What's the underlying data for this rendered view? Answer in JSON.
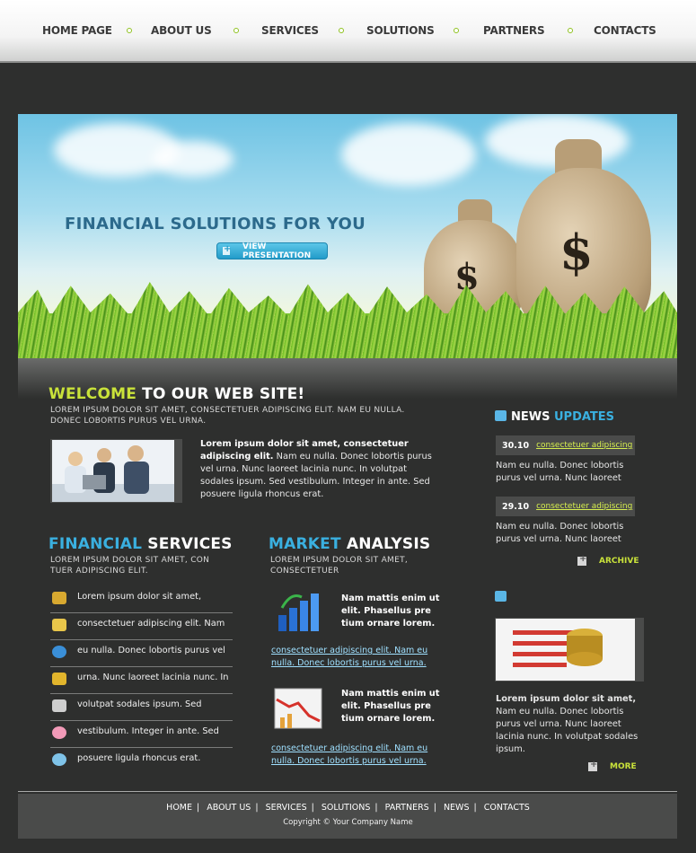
{
  "nav": {
    "items": [
      "HOME PAGE",
      "ABOUT US",
      "SERVICES",
      "SOLUTIONS",
      "PARTNERS",
      "CONTACTS"
    ]
  },
  "hero": {
    "title": "FINANCIAL SOLUTIONS FOR YOU",
    "button_label": "VIEW PRESENTATION"
  },
  "welcome": {
    "title_highlight": "WELCOME",
    "title_rest": " TO OUR WEB SITE!",
    "subtitle": "LOREM IPSUM DOLOR SIT AMET, CONSECTETUER ADIPISCING ELIT. NAM EU NULLA. DONEC LOBORTIS PURUS VEL URNA.",
    "lead_bold": "Lorem ipsum dolor sit amet, consectetuer adipiscing elit.",
    "lead_text": " Nam eu nulla. Donec lobortis purus vel urna. Nunc laoreet lacinia nunc. In volutpat sodales ipsum. Sed vestibulum. Integer in ante. Sed posuere ligula rhoncus erat."
  },
  "services": {
    "title_highlight": "FINANCIAL",
    "title_rest": " SERVICES",
    "subtitle": "LOREM IPSUM DOLOR SIT AMET, CON TUER ADIPISCING ELIT.",
    "items": [
      {
        "text": "Lorem ipsum dolor sit amet,",
        "icon": "chart-icon",
        "color": "#d8a930"
      },
      {
        "text": "consectetuer adipiscing elit. Nam",
        "icon": "cash-icon",
        "color": "#e8c64a"
      },
      {
        "text": "eu nulla. Donec lobortis purus vel",
        "icon": "euro-icon",
        "color": "#3a8fd8"
      },
      {
        "text": "urna. Nunc laoreet lacinia nunc. In",
        "icon": "coins-icon",
        "color": "#e2b52c"
      },
      {
        "text": "volutpat sodales ipsum. Sed",
        "icon": "calculator-icon",
        "color": "#cfcfcf"
      },
      {
        "text": "vestibulum. Integer in ante. Sed",
        "icon": "piggy-bank-icon",
        "color": "#f29ab8"
      },
      {
        "text": "posuere ligula rhoncus erat.",
        "icon": "weather-icon",
        "color": "#7fc3e8"
      }
    ]
  },
  "market": {
    "title_highlight": "MARKET",
    "title_rest": " ANALYSIS",
    "subtitle": "LOREM IPSUM DOLOR SIT AMET, CONSECTETUER",
    "items": [
      {
        "title": "Nam mattis enim ut elit. Phasellus pre tium ornare lorem.",
        "link": "consectetuer adipiscing elit. Nam eu nulla. Donec lobortis purus vel urna.",
        "icon": "bar-chart-up-icon"
      },
      {
        "title": "Nam mattis enim ut elit. Phasellus pre tium ornare lorem.",
        "link": "consectetuer adipiscing elit. Nam eu nulla. Donec lobortis purus vel urna.",
        "icon": "chart-down-icon"
      }
    ]
  },
  "news": {
    "title_white": "NEWS",
    "title_blue": " UPDATES",
    "items": [
      {
        "date": "30.10",
        "link": "consectetuer adipiscing",
        "text": "Nam eu nulla. Donec lobortis purus vel urna. Nunc laoreet"
      },
      {
        "date": "29.10",
        "link": "consectetuer adipiscing",
        "text": "Nam eu nulla. Donec lobortis purus vel urna. Nunc laoreet"
      }
    ],
    "archive_label": "ARCHIVE",
    "feature_bold": "Lorem ipsum dolor sit amet,",
    "feature_text": "Nam eu nulla. Donec lobortis purus vel urna. Nunc laoreet lacinia nunc. In volutpat sodales ipsum.",
    "more_label": "MORE"
  },
  "footer": {
    "links": [
      "HOME",
      "ABOUT US",
      "SERVICES",
      "SOLUTIONS",
      "PARTNERS",
      "NEWS",
      "CONTACTS"
    ],
    "copyright": "Copyright © Your Company Name"
  },
  "colors": {
    "background": "#2e2f2e",
    "accent_green": "#c9e23a",
    "accent_blue": "#3ab0e0",
    "nav_dot": "#8fc21f"
  }
}
